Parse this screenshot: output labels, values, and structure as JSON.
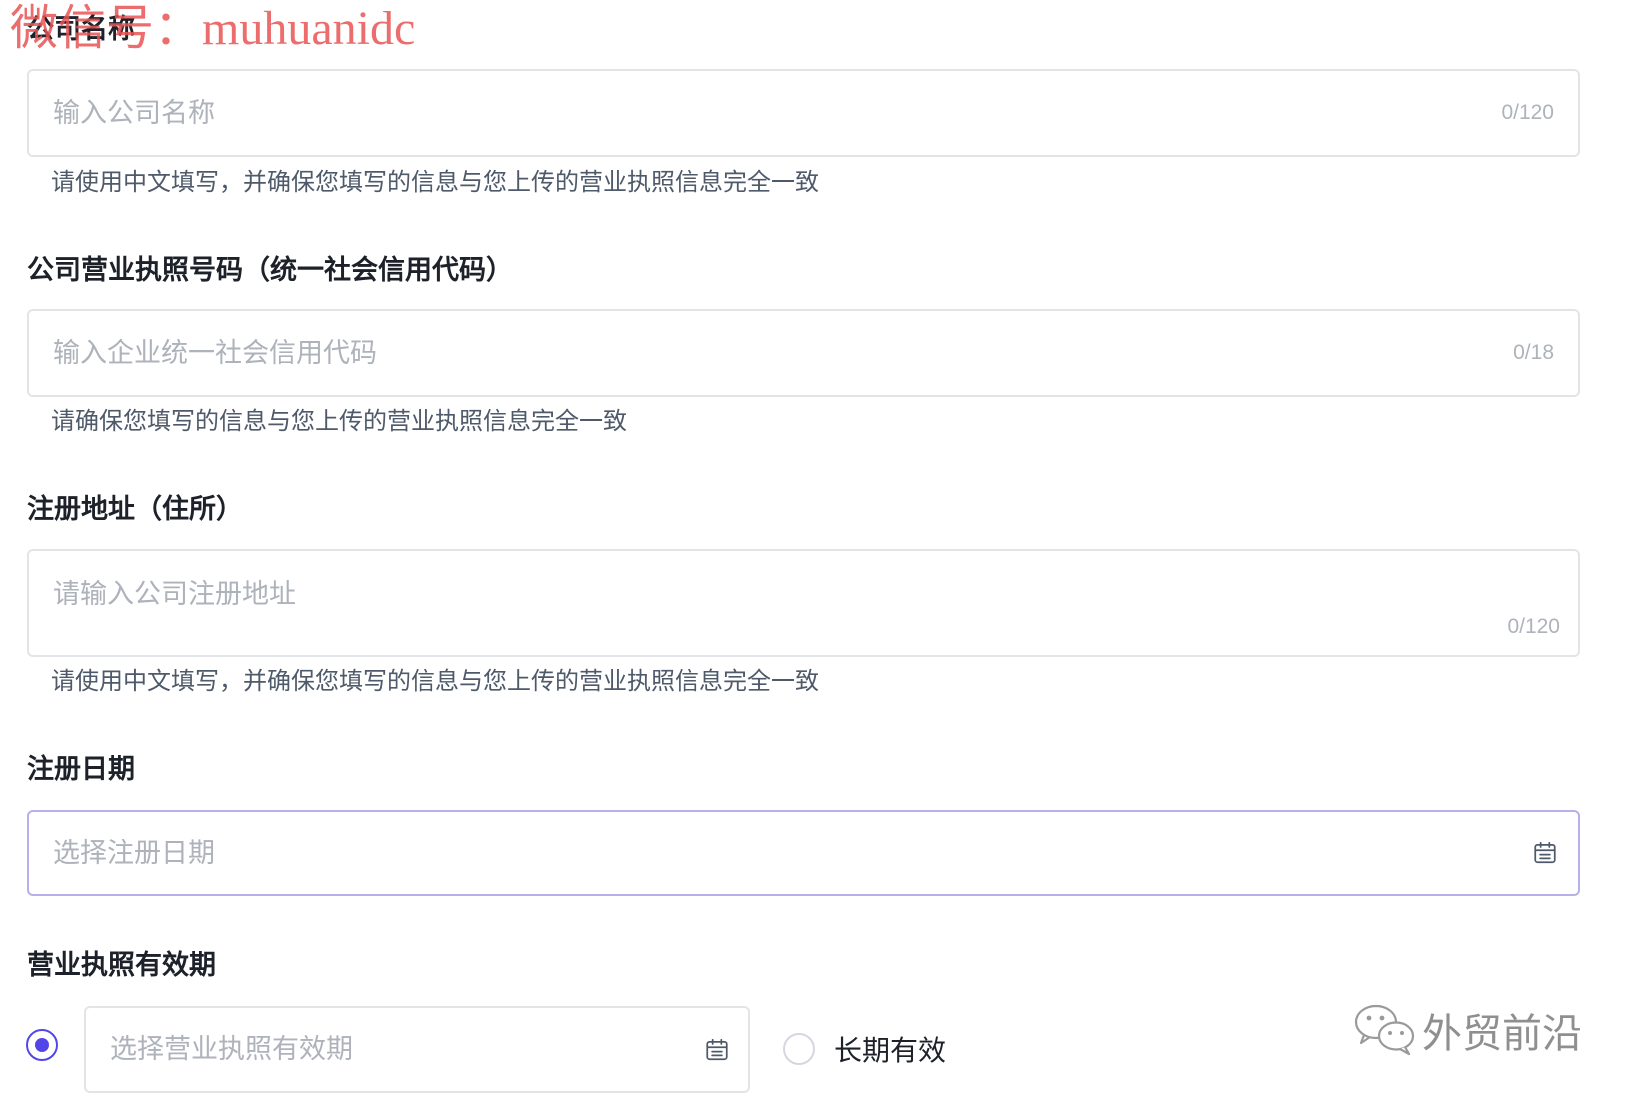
{
  "watermark": {
    "text": "微信号：muhuanidc"
  },
  "fields": {
    "company_name": {
      "label": "公司名称",
      "placeholder": "输入公司名称",
      "counter": "0/120",
      "helper": "请使用中文填写，并确保您填写的信息与您上传的营业执照信息完全一致"
    },
    "license_number": {
      "label": "公司营业执照号码（统一社会信用代码）",
      "placeholder": "输入企业统一社会信用代码",
      "counter": "0/18",
      "helper": "请确保您填写的信息与您上传的营业执照信息完全一致"
    },
    "registered_address": {
      "label": "注册地址（住所）",
      "placeholder": "请输入公司注册地址",
      "counter": "0/120",
      "helper": "请使用中文填写，并确保您填写的信息与您上传的营业执照信息完全一致"
    },
    "registration_date": {
      "label": "注册日期",
      "placeholder": "选择注册日期",
      "icon": "calendar-icon"
    },
    "license_validity": {
      "label": "营业执照有效期",
      "date_placeholder": "选择营业执照有效期",
      "icon": "calendar-icon",
      "fixed_period_selected": true,
      "long_term_label": "长期有效",
      "long_term_selected": false
    }
  },
  "corner_watermark": {
    "icon": "wechat-icon",
    "text": "外贸前沿"
  },
  "colors": {
    "accent": "#5247e6",
    "focus_border": "#b6b1ea",
    "label_text": "#1d2129",
    "placeholder_text": "#aeb2bb",
    "helper_text": "#4e5969",
    "watermark_red": "#e85454"
  }
}
